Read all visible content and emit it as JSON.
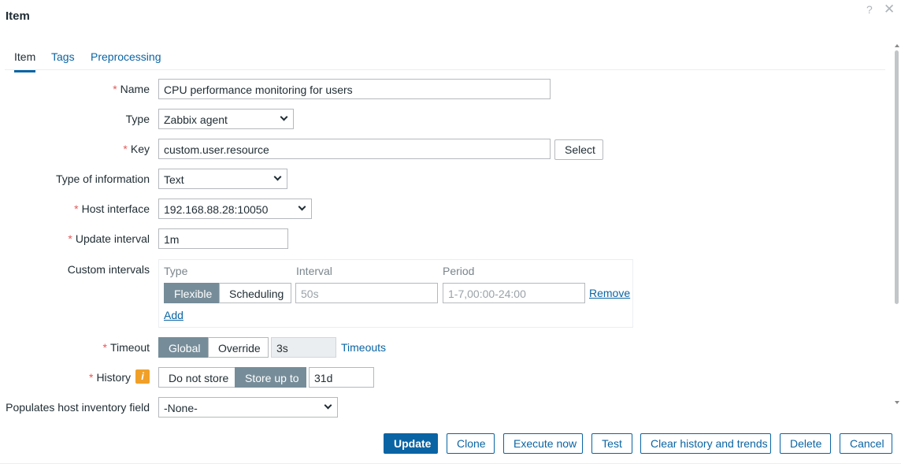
{
  "dialog": {
    "title": "Item",
    "help_glyph": "?",
    "close_glyph": "✕"
  },
  "tabs": [
    {
      "label": "Item"
    },
    {
      "label": "Tags"
    },
    {
      "label": "Preprocessing"
    }
  ],
  "form": {
    "name": {
      "label": "Name",
      "value": "CPU performance monitoring for users"
    },
    "type": {
      "label": "Type",
      "value": "Zabbix agent"
    },
    "key": {
      "label": "Key",
      "value": "custom.user.resource",
      "select_label": "Select"
    },
    "type_of_information": {
      "label": "Type of information",
      "value": "Text"
    },
    "host_interface": {
      "label": "Host interface",
      "value": "192.168.88.28:10050"
    },
    "update_interval": {
      "label": "Update interval",
      "value": "1m"
    },
    "custom_intervals": {
      "label": "Custom intervals",
      "headers": {
        "type": "Type",
        "interval": "Interval",
        "period": "Period"
      },
      "row": {
        "flexible": "Flexible",
        "scheduling": "Scheduling",
        "interval_placeholder": "50s",
        "period_placeholder": "1-7,00:00-24:00",
        "remove": "Remove"
      },
      "add": "Add"
    },
    "timeout": {
      "label": "Timeout",
      "global": "Global",
      "override": "Override",
      "value": "3s",
      "link": "Timeouts"
    },
    "history": {
      "label": "History",
      "info_glyph": "i",
      "do_not_store": "Do not store",
      "store_up_to": "Store up to",
      "value": "31d"
    },
    "inventory": {
      "label": "Populates host inventory field",
      "value": "-None-"
    },
    "required_mark": "*"
  },
  "footer": {
    "update": "Update",
    "clone": "Clone",
    "execute_now": "Execute now",
    "test": "Test",
    "clear_history": "Clear history and trends",
    "delete": "Delete",
    "cancel": "Cancel"
  }
}
